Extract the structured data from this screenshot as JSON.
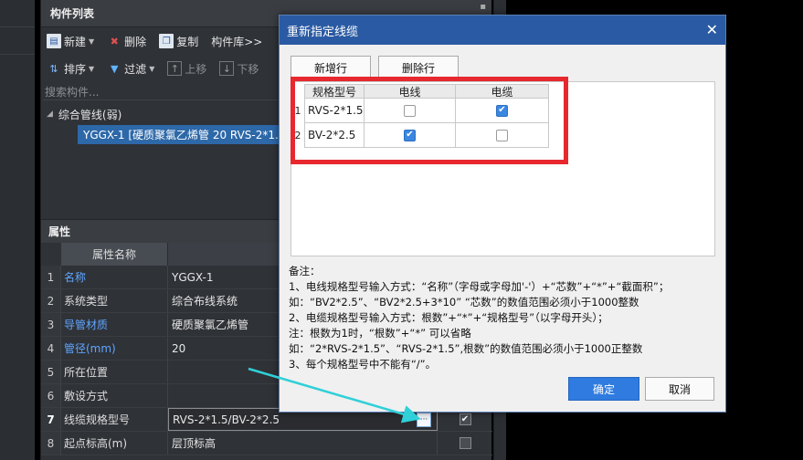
{
  "component_list": {
    "title": "构件列表",
    "toolbar": {
      "new": "新建",
      "delete": "删除",
      "copy": "复制",
      "library": "构件库>>",
      "sort": "排序",
      "filter": "过滤",
      "up": "上移",
      "down": "下移"
    },
    "search_placeholder": "搜索构件...",
    "tree": {
      "parent": "综合管线(弱)",
      "child": "YGGX-1 [硬质聚氯乙烯管 20 RVS-2*1.5"
    }
  },
  "properties": {
    "title": "属性",
    "column_name": "属性名称",
    "rows": [
      {
        "n": "1",
        "name": "名称",
        "value": "YGGX-1",
        "blue": true
      },
      {
        "n": "2",
        "name": "系统类型",
        "value": "综合布线系统",
        "blue": false
      },
      {
        "n": "3",
        "name": "导管材质",
        "value": "硬质聚氯乙烯管",
        "blue": true
      },
      {
        "n": "4",
        "name": "管径(mm)",
        "value": "20",
        "blue": true
      },
      {
        "n": "5",
        "name": "所在位置",
        "value": "",
        "blue": false
      },
      {
        "n": "6",
        "name": "敷设方式",
        "value": "",
        "blue": false
      },
      {
        "n": "7",
        "name": "线缆规格型号",
        "value": "RVS-2*1.5/BV-2*2.5",
        "blue": false,
        "checked": true
      },
      {
        "n": "8",
        "name": "起点标高(m)",
        "value": "层顶标高",
        "blue": false,
        "checked": false
      }
    ]
  },
  "dialog": {
    "title": "重新指定线缆",
    "close": "✕",
    "add_row": "新增行",
    "delete_row": "删除行",
    "grid": {
      "headers": [
        "规格型号",
        "电线",
        "电缆"
      ],
      "rows": [
        {
          "n": "1",
          "spec": "RVS-2*1.5",
          "wire": false,
          "cable": true
        },
        {
          "n": "2",
          "spec": "BV-2*2.5",
          "wire": true,
          "cable": false
        }
      ]
    },
    "notes": [
      "备注：",
      "1、电线规格型号输入方式：“名称”（字母或字母加'-'）+“芯数”+“*”+“截面积”；",
      "如：“BV2*2.5”、“BV2*2.5+3*10”  “芯数”的数值范围必须小于1000整数",
      "2、电缆规格型号输入方式：根数”+“*”+“规格型号”（以字母开头）；",
      "注：根数为1时，“根数”+“*”  可以省略",
      "如：“2*RVS-2*1.5”、“RVS-2*1.5”,根数”的数值范围必须小于1000正整数",
      "3、每个规格型号中不能有“/”。"
    ],
    "ok": "确定",
    "cancel": "取消"
  },
  "colors": {
    "dialog_title_bg": "#2a5aa3",
    "highlight_red": "#e8282f",
    "annotation_arrow": "#2fd0d8",
    "checkbox_on": "#3b86e0"
  }
}
